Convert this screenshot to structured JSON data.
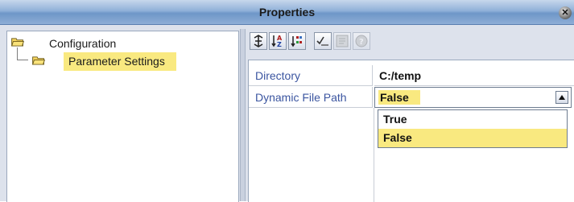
{
  "window": {
    "title": "Properties"
  },
  "tree": {
    "root": {
      "label": "Configuration"
    },
    "child": {
      "label": "Parameter Settings"
    }
  },
  "toolbar": {
    "buttons": [
      "expand-icon",
      "sort-az-icon",
      "sort-category-icon",
      "validate-icon",
      "property-pages-icon",
      "help-icon"
    ]
  },
  "properties": {
    "rows": [
      {
        "name": "Directory",
        "value": "C:/temp"
      },
      {
        "name": "Dynamic File Path",
        "value": "False"
      }
    ],
    "dropdown_options": [
      "True",
      "False"
    ],
    "selected_option": "False"
  },
  "colors": {
    "accent": "#f9e980",
    "title_bar": "#8fb0d8"
  }
}
